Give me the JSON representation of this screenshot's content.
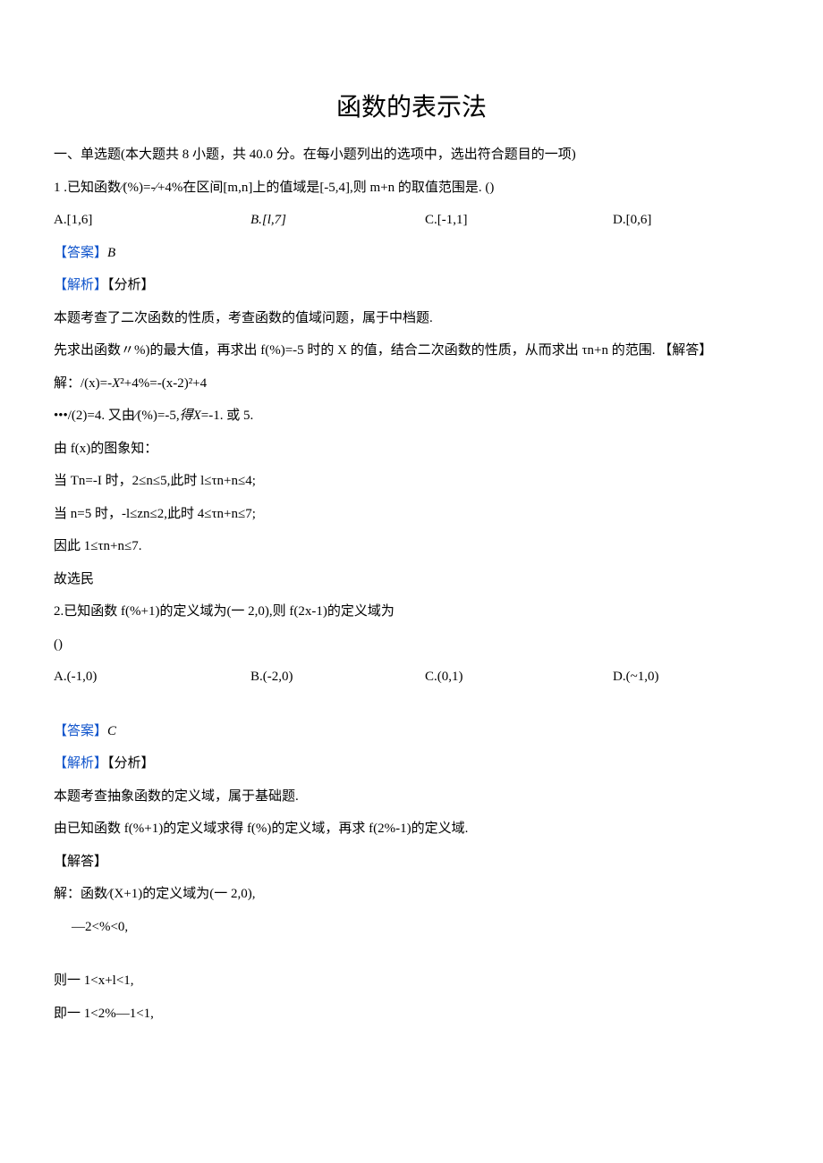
{
  "title": "函数的表示法",
  "section1_heading": "一、单选题(本大题共 8 小题，共 40.0 分。在每小题列出的选项中，选出符合题目的一项)",
  "q1": {
    "stem": "1 .已知函数∕(%)=-∕+4%在区间[m,n]上的值域是[-5,4],则 m+n 的取值范围是. ()",
    "optA": "A.[1,6]",
    "optB": "B.[l,7]",
    "optC": "C.[-1,1]",
    "optD": "D.[0,6]",
    "answer_label": "【答案】",
    "answer": "B",
    "analysis_label_1": "【解析】",
    "analysis_label_2": "【分析】",
    "line1": "本题考查了二次函数的性质，考查函数的值域问题，属于中档题.",
    "line2": "先求出函数〃%)的最大值，再求出 f(%)=-5 时的 X 的值，结合二次函数的性质，从而求出 τn+n 的范围. 【解答】",
    "line3_pre": "解：/(x)=-",
    "line3_x2": "X",
    "line3_mid": "²+4%=-(x-2)²+4",
    "line4_pre": "•••/(2)=4. 又由∕(%)=-5,",
    "line4_dei": "得",
    "line4_x": "X",
    "line4_post": "=-1. 或 5.",
    "line5": "由 f(x)的图象知：",
    "line6": "当 Tn=-I 时，2≤n≤5,此时 l≤τn+n≤4;",
    "line7": "当 n=5 时，-l≤zn≤2,此时 4≤τn+n≤7;",
    "line8": "因此 1≤τn+n≤7.",
    "line9": "故选民"
  },
  "q2": {
    "stem": "2.已知函数 f(%+1)的定义域为(一 2,0),则 f(2x-1)的定义域为",
    "paren": "()",
    "optA": "A.(-1,0)",
    "optB": "B.(-2,0)",
    "optC": "C.(0,1)",
    "optD": "D.(~1,0)",
    "answer_label": "【答案】",
    "answer": "C",
    "analysis_label_1": "【解析】",
    "analysis_label_2": "【分析】",
    "line1": "本题考查抽象函数的定义域，属于基础题.",
    "line2": "由已知函数 f(%+1)的定义域求得 f(%)的定义域，再求 f(2%-1)的定义域.",
    "line3": "【解答】",
    "line4": "解：函数∕(X+1)的定义域为(一 2,0),",
    "line5": "—2<%<0,",
    "line6": "则一 1<x+l<1,",
    "line7": "即一 1<2%—1<1,"
  }
}
